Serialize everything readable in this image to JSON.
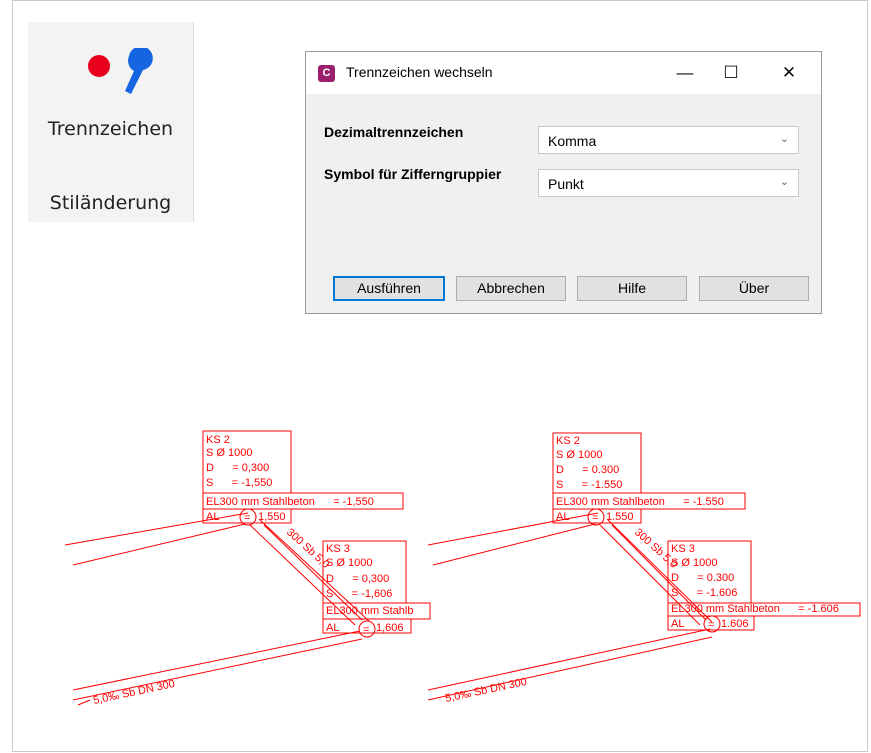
{
  "ribbon": {
    "button_label": "Trennzeichen",
    "group_label": "Stiländerung",
    "icon": "comma-dot-icon",
    "dot_color": "#e8001c",
    "comma_color": "#1565e0"
  },
  "dialog": {
    "title": "Trennzeichen wechseln",
    "app_icon_letter": "C",
    "minimize_glyph": "—",
    "maximize_glyph": "☐",
    "close_glyph": "✕",
    "fields": {
      "decimal_label": "Dezimaltrennzeichen",
      "decimal_value": "Komma",
      "grouping_label": "Symbol für Zifferngruppier",
      "grouping_value": "Punkt"
    },
    "buttons": {
      "run": "Ausführen",
      "cancel": "Abbrechen",
      "help": "Hilfe",
      "about": "Über"
    }
  },
  "drawings": {
    "left": {
      "ks2": {
        "name": "KS 2",
        "s_dia": "S Ø 1000",
        "d": "D      = 0,300",
        "s": "S      = -1,550"
      },
      "ks2_el": "EL300 mm Stahlbeton      = -1,550",
      "ks2_al_prefix": "AL",
      "ks2_al_value": "1,550",
      "pipe_label": "300 Sb 5,0",
      "ks3": {
        "name": "KS 3",
        "s_dia": "S Ø 1000",
        "d": "D      = 0,300",
        "s": "S      = -1,606"
      },
      "ks3_el": "EL300 mm Stahlb",
      "ks3_al_prefix": "AL",
      "ks3_al_value": "1,606",
      "bottom_pipe": "5,0‰ Sb DN  300"
    },
    "right": {
      "ks2": {
        "name": "KS 2",
        "s_dia": "S Ø 1000",
        "d": "D      = 0.300",
        "s": "S      = -1.550"
      },
      "ks2_el": "EL300 mm Stahlbeton      = -1.550",
      "ks2_al_prefix": "AL",
      "ks2_al_value": "1.550",
      "pipe_label": "300 Sb 5,0",
      "ks3": {
        "name": "KS 3",
        "s_dia": "S Ø 1000",
        "d": "D      = 0.300",
        "s": "S      = -1.606"
      },
      "ks3_el": "EL300 mm Stahlbeton      = -1.606",
      "ks3_al_prefix": "AL",
      "ks3_al_value": "1.606",
      "bottom_pipe": "5,0‰ Sb DN  300"
    },
    "line_color": "#ff0000"
  }
}
